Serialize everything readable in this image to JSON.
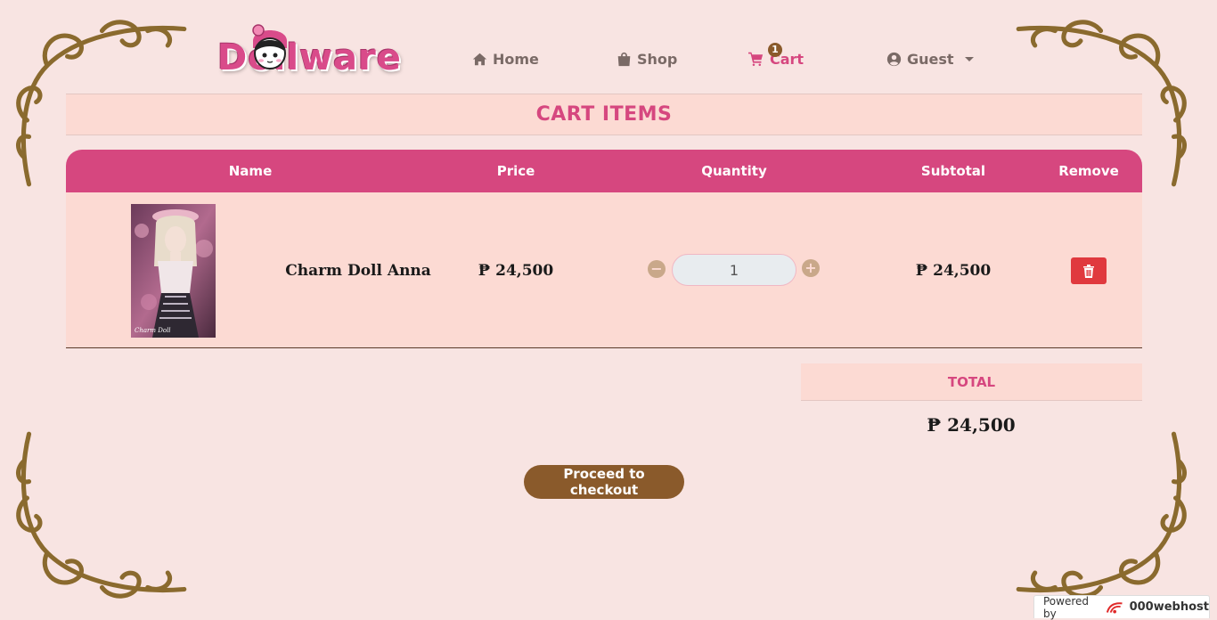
{
  "nav": {
    "logo_text": "Dollware",
    "home": "Home",
    "shop": "Shop",
    "cart": "Cart",
    "cart_count": "1",
    "user": "Guest"
  },
  "page": {
    "heading": "CART ITEMS"
  },
  "table": {
    "headers": [
      "Name",
      "Price",
      "Quantity",
      "Subtotal",
      "Remove"
    ],
    "rows": [
      {
        "name": "Charm Doll Anna",
        "price": "₱ 24,500",
        "quantity": "1",
        "subtotal": "₱ 24,500"
      }
    ]
  },
  "total": {
    "label": "TOTAL",
    "value": "₱ 24,500"
  },
  "checkout_label": "Proceed to checkout",
  "footer": {
    "powered_by": "Powered by",
    "host": "000webhost"
  },
  "colors": {
    "accent_pink": "#d6477f",
    "brown": "#8a5a2b",
    "band": "#fcdad3",
    "background": "#f8e4e2",
    "danger": "#e0393e"
  },
  "icons": [
    "home-icon",
    "shopping-bag-icon",
    "cart-icon",
    "user-circle-icon",
    "minus-circle-icon",
    "plus-circle-icon",
    "trash-icon",
    "webhost-logo-icon"
  ]
}
